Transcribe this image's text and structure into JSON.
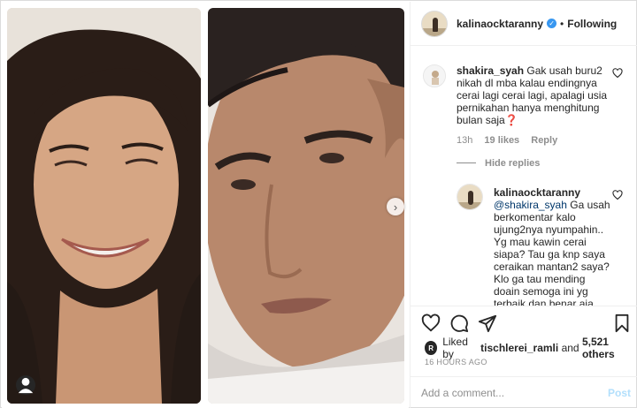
{
  "post": {
    "author": "kalinaocktaranny",
    "follow_state": "Following",
    "dot": "•"
  },
  "comments": [
    {
      "username": "shakira_syah",
      "text": "Gak usah buru2 nikah dl mba kalau endingnya cerai lagi cerai lagi, apalagi usia pernikahan hanya menghitung bulan saja❓",
      "time": "13h",
      "likes": "19 likes",
      "reply": "Reply",
      "hide_replies": "Hide replies"
    },
    {
      "username": "kalinaocktaranny",
      "mention": "@shakira_syah",
      "text": "Ga usah berkomentar kalo ujung2nya nyumpahin.. Yg mau kawin cerai siapa? Tau ga knp saya ceraikan mantan2 saya? Klo ga tau mending doain semoga ini yg terbaik dan benar aja"
    }
  ],
  "likes": {
    "prefix": "Liked by",
    "user": "tischlerei_ramli",
    "and": "and",
    "others": "5,521 others",
    "avatar_letter": "R"
  },
  "timestamp": "16 HOURS AGO",
  "add_comment": {
    "placeholder": "Add a comment...",
    "post_label": "Post"
  },
  "icons": {
    "like": "heart-icon",
    "comment": "comment-icon",
    "share": "share-icon",
    "save": "bookmark-icon",
    "next": "chevron-right-icon",
    "tag": "user-tag-icon"
  },
  "colors": {
    "link": "#00376b",
    "verified": "#3897f0",
    "muted": "#8e8e8e",
    "post_disabled": "#b2dffc"
  }
}
